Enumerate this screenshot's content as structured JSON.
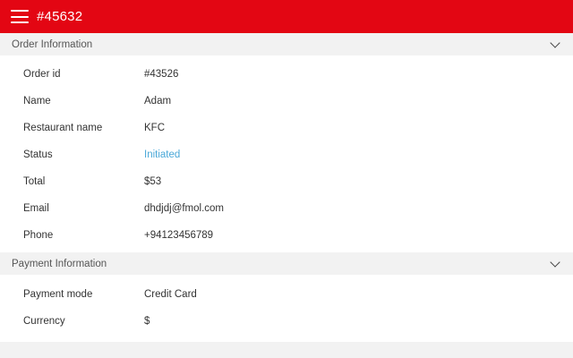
{
  "toolbar": {
    "title": "#45632"
  },
  "order_section": {
    "title": "Order Information",
    "rows": [
      {
        "label": "Order id",
        "value": "#43526"
      },
      {
        "label": "Name",
        "value": "Adam"
      },
      {
        "label": "Restaurant name",
        "value": "KFC"
      },
      {
        "label": "Status",
        "value": "Initiated"
      },
      {
        "label": "Total",
        "value": "$53"
      },
      {
        "label": "Email",
        "value": "dhdjdj@fmol.com"
      },
      {
        "label": "Phone",
        "value": "+94123456789"
      }
    ]
  },
  "payment_section": {
    "title": "Payment Information",
    "rows": [
      {
        "label": "Payment mode",
        "value": "Credit Card"
      },
      {
        "label": "Currency",
        "value": "$"
      }
    ]
  },
  "colors": {
    "toolbar": "#e30613",
    "status": "#4aa8d8"
  },
  "icons": {
    "menu": "hamburger-menu-icon",
    "expand": "chevron-down-icon"
  }
}
